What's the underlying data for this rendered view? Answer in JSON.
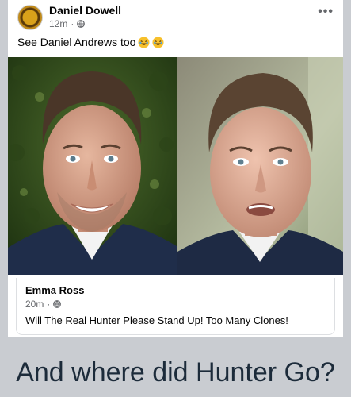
{
  "post": {
    "author": "Daniel Dowell",
    "time": "12m",
    "more_label": "•••",
    "text": "See Daniel Andrews too"
  },
  "shared_post": {
    "author": "Emma Ross",
    "time": "20m",
    "text": "Will The Real Hunter Please Stand Up! Too Many Clones!"
  },
  "caption": "And where did Hunter Go?",
  "colors": {
    "background": "#c9ccd1",
    "card": "#ffffff",
    "secondary_text": "#65676b",
    "caption_text": "#1c2b3a"
  }
}
